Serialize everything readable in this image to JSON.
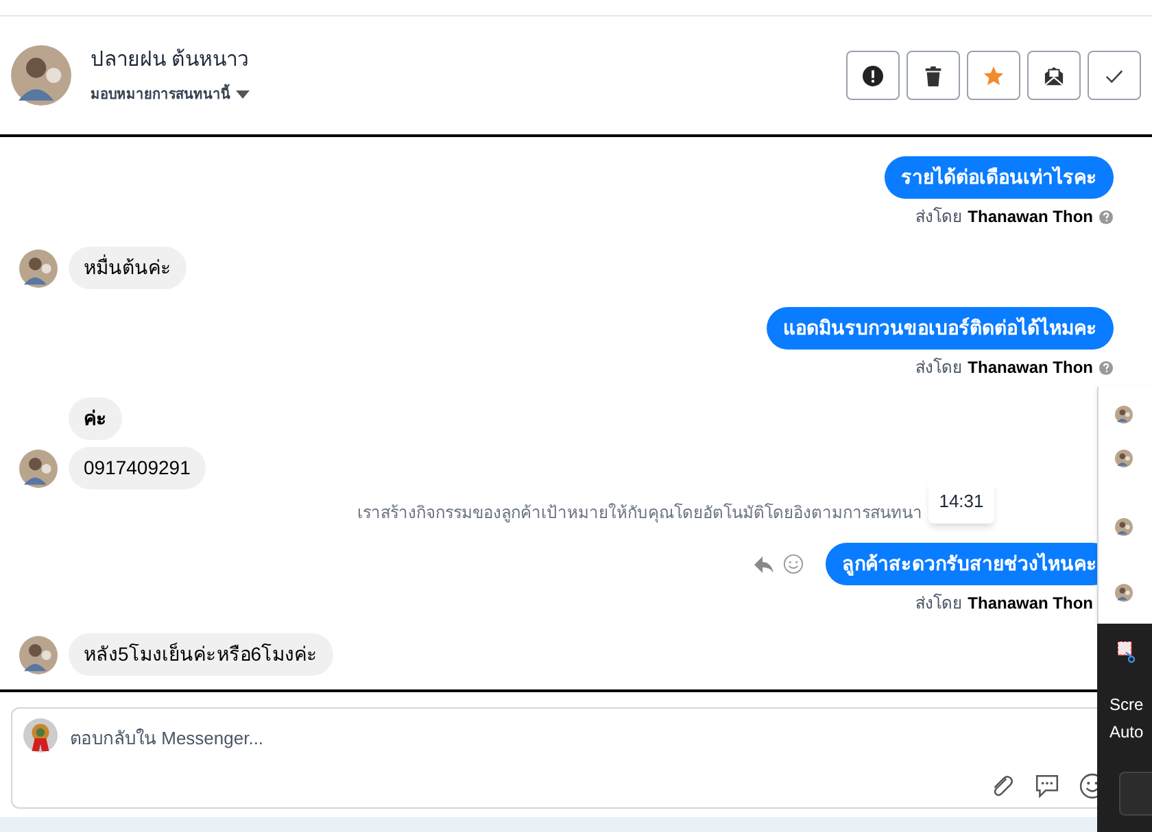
{
  "contact": {
    "name": "ปลายฝน ต้นหนาว",
    "assign_label": "มอบหมายการสนทนานี้"
  },
  "header_actions": [
    {
      "kind": "report"
    },
    {
      "kind": "delete"
    },
    {
      "kind": "star"
    },
    {
      "kind": "mail"
    },
    {
      "kind": "done"
    }
  ],
  "messages": [
    {
      "kind": "outgoing",
      "text": "รายได้ต่อเดือนเท่าไรคะ",
      "sent_by_label": "ส่งโดย",
      "sender": "Thanawan Thon"
    },
    {
      "kind": "incoming",
      "text": "หมื่นต้นค่ะ",
      "avatar": true
    },
    {
      "kind": "outgoing",
      "text": "แอดมินรบกวนขอเบอร์ติดต่อได้ไหมคะ",
      "sent_by_label": "ส่งโดย",
      "sender": "Thanawan Thon"
    },
    {
      "kind": "incoming",
      "text": "ค่ะ",
      "avatar": false
    },
    {
      "kind": "incoming",
      "text": "0917409291",
      "avatar": true
    },
    {
      "kind": "system",
      "text": "เราสร้างกิจกรรมของลูกค้าเป้าหมายให้กับคุณโดยอัตโนมัติโดยอิงตามการสนทนา",
      "tooltip": "14:31"
    },
    {
      "kind": "outgoing",
      "text": "ลูกค้าสะดวกรับสายช่วงไหนคะ",
      "sent_by_label": "ส่งโดย",
      "sender": "Thanawan Thon",
      "hover_actions": true
    },
    {
      "kind": "incoming",
      "text": "หลัง5โมงเย็นค่ะหรือ6โมงค่ะ",
      "avatar": true
    }
  ],
  "composer": {
    "placeholder": "ตอบกลับใน Messenger..."
  },
  "notification": {
    "line_1": "Scre",
    "line_2": "Auto"
  }
}
